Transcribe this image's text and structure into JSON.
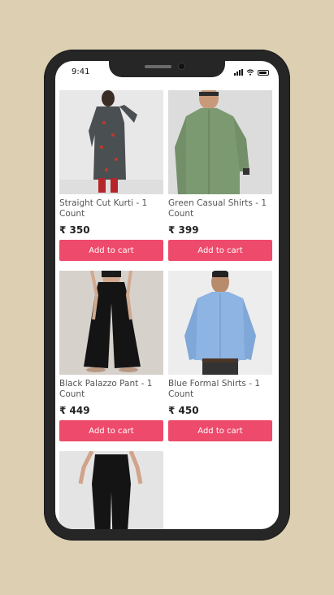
{
  "status_bar": {
    "time": "9:41"
  },
  "products": [
    {
      "name": "Straight Cut Kurti - 1 Count",
      "price": "₹ 350",
      "cta": "Add to cart"
    },
    {
      "name": "Green Casual Shirts - 1 Count",
      "price": "₹ 399",
      "cta": "Add to cart"
    },
    {
      "name": "Black Palazzo Pant - 1 Count",
      "price": "₹ 449",
      "cta": "Add to cart"
    },
    {
      "name": "Blue Formal Shirts - 1 Count",
      "price": "₹ 450",
      "cta": "Add to cart"
    },
    {
      "name": "",
      "price": "",
      "cta": ""
    }
  ],
  "colors": {
    "accent": "#ee4a6b",
    "background": "#dccfb2",
    "phone": "#262626"
  }
}
